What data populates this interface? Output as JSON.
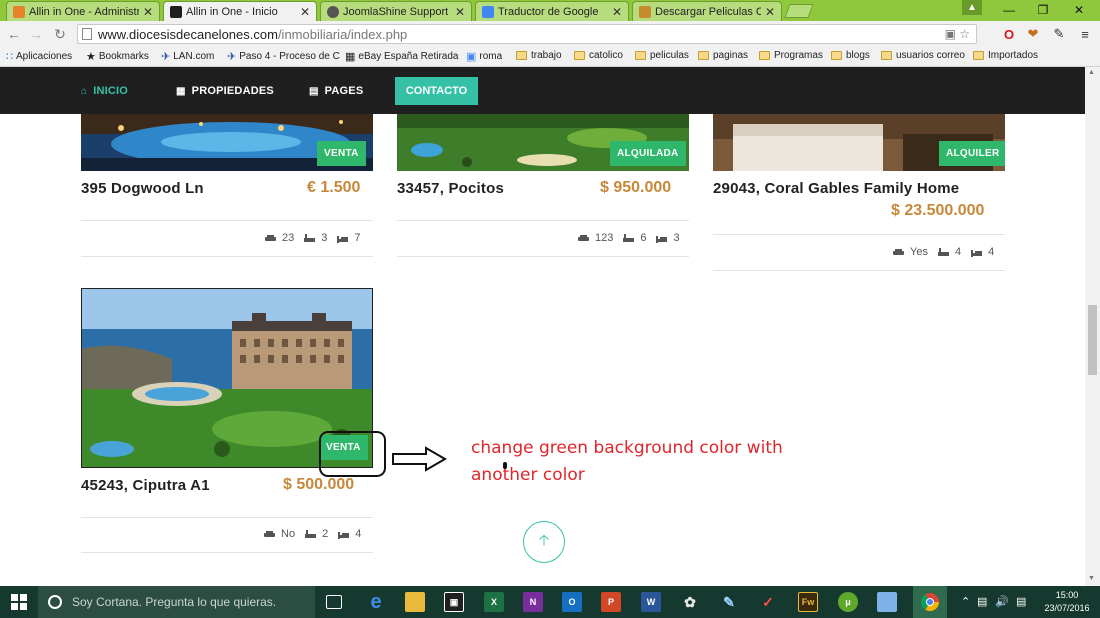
{
  "browser": {
    "tabs": [
      {
        "title": "Allin in One - Administrac",
        "active": false,
        "favicon_color": "#e8832a"
      },
      {
        "title": "Allin in One - Inicio",
        "active": true,
        "favicon_color": "#1d1d1d"
      },
      {
        "title": "JoomlaShine Support Foru",
        "active": false,
        "favicon_color": "#555555"
      },
      {
        "title": "Traductor de Google",
        "active": false,
        "favicon_color": "#4285f4"
      },
      {
        "title": "Descargar Peliculas Castel",
        "active": false,
        "favicon_color": "#c58b2d"
      }
    ],
    "url_host": "www.diocesisdecanelones.com",
    "url_path": "/inmobiliaria/index.php",
    "bookmarks": [
      {
        "label": "Aplicaciones",
        "icon": "apps-grid-icon"
      },
      {
        "label": "Bookmarks",
        "icon": "star-icon"
      },
      {
        "label": "LAN.com",
        "icon": "plane-icon"
      },
      {
        "label": "Paso 4 - Proceso de C",
        "icon": "plane-icon"
      },
      {
        "label": "eBay España Retirada",
        "icon": "shopping-bag-icon"
      },
      {
        "label": "roma",
        "icon": "translate-icon"
      },
      {
        "label": "trabajo",
        "icon": "folder-icon"
      },
      {
        "label": "catolico",
        "icon": "folder-icon"
      },
      {
        "label": "peliculas",
        "icon": "folder-icon"
      },
      {
        "label": "paginas",
        "icon": "folder-icon"
      },
      {
        "label": "Programas",
        "icon": "folder-icon"
      },
      {
        "label": "blogs",
        "icon": "folder-icon"
      },
      {
        "label": "usuarios correo",
        "icon": "folder-icon"
      },
      {
        "label": "Importados",
        "icon": "folder-icon"
      }
    ]
  },
  "site": {
    "nav": {
      "inicio": "INICIO",
      "propiedades": "PROPIEDADES",
      "pages": "PAGES",
      "contacto": "CONTACTO"
    },
    "properties": [
      {
        "title": "395 Dogwood Ln",
        "price": "€ 1.500",
        "badge": "VENTA",
        "garage": "23",
        "baths": "3",
        "beds": "7"
      },
      {
        "title": "33457, Pocitos",
        "price": "$ 950.000",
        "badge": "ALQUILADA",
        "garage": "123",
        "baths": "6",
        "beds": "3"
      },
      {
        "title": "29043, Coral Gables Family Home",
        "price": "$ 23.500.000",
        "badge": "ALQUILER",
        "garage": "Yes",
        "baths": "4",
        "beds": "4"
      },
      {
        "title": "45243, Ciputra A1",
        "price": "$ 500.000",
        "badge": "VENTA",
        "garage": "No",
        "baths": "2",
        "beds": "4"
      }
    ],
    "annotation": {
      "line1": "change green background color with",
      "line2": "another color"
    },
    "colors": {
      "accent": "#34c1a6",
      "badge_green": "#2fb86b",
      "price": "#c8883a",
      "nav_bg": "#1f1f1f"
    }
  },
  "taskbar": {
    "cortana_placeholder": "Soy Cortana. Pregunta lo que quieras.",
    "time": "15:00",
    "date": "23/07/2016"
  }
}
